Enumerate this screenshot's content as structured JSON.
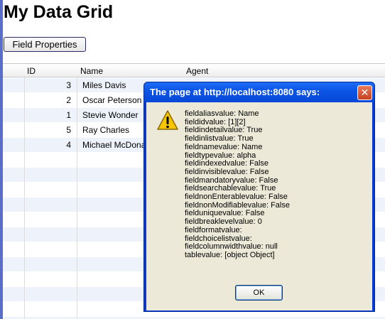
{
  "page": {
    "title": "My Data Grid",
    "field_properties_button": "Field Properties"
  },
  "grid": {
    "columns": [
      "ID",
      "Name",
      "Agent"
    ],
    "rows": [
      {
        "id": "3",
        "name": "Miles Davis"
      },
      {
        "id": "2",
        "name": "Oscar Peterson"
      },
      {
        "id": "1",
        "name": "Stevie Wonder"
      },
      {
        "id": "5",
        "name": "Ray Charles"
      },
      {
        "id": "4",
        "name": "Michael McDonald"
      }
    ]
  },
  "dialog": {
    "title": "The page at http://localhost:8080 says:",
    "close_glyph": "✕",
    "icon": "warning-icon",
    "lines": [
      "fieldaliasvalue: Name",
      "fieldidvalue: [1][2]",
      "fieldindetailvalue: True",
      "fieldinlistvalue: True",
      "fieldnamevalue: Name",
      "fieldtypevalue: alpha",
      "fieldindexedvalue: False",
      "fieldinvisiblevalue: False",
      "fieldmandatoryvalue: False",
      "fieldsearchablevalue: True",
      "fieldnonEnterablevalue: False",
      "fieldnonModifiablevalue: False",
      "fielduniquevalue: False",
      "fieldbreaklevelvalue: 0",
      "fieldformatvalue:",
      "fieldchoicelistvalue:",
      "fieldcolumnwidthvalue: null",
      "tablevalue: [object Object]"
    ],
    "ok_label": "OK"
  },
  "colors": {
    "title_bar": "#0c55e6",
    "dialog_body": "#ece9d8",
    "row_alt": "#eef3fb",
    "left_accent": "#5a6ec8"
  }
}
